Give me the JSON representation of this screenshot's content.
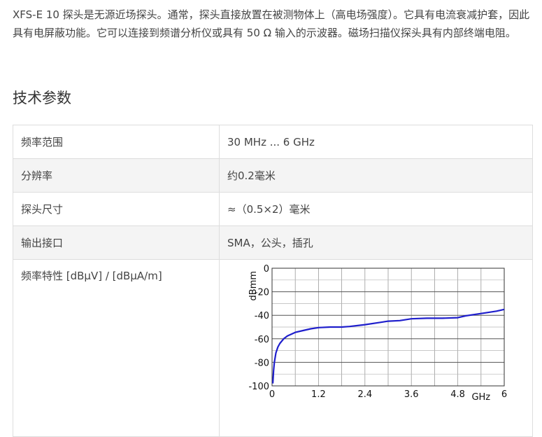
{
  "intro": "XFS-E 10 探头是无源近场探头。通常，探头直接放置在被测物体上（高电场强度）。它具有电流衰减护套，因此具有电屏蔽功能。它可以连接到频谱分析仪或具有 50 Ω 输入的示波器。磁场扫描仪探头具有内部终端电阻。",
  "section_title": "技术参数",
  "specs": [
    {
      "key": "频率范围",
      "value": "30 MHz ... 6 GHz"
    },
    {
      "key": "分辨率",
      "value": "约0.2毫米"
    },
    {
      "key": "探头尺寸",
      "value": "≈（0.5×2）毫米"
    },
    {
      "key": "输出接口",
      "value": "SMA，公头，插孔"
    },
    {
      "key": "频率特性 [dBµV] / [dBµA/m]"
    }
  ],
  "chart_data": {
    "type": "line",
    "xlabel": "GHz",
    "ylabel": "dBmm",
    "xlim": [
      0,
      6
    ],
    "ylim": [
      -100,
      0
    ],
    "xticks": [
      "0",
      "1.2",
      "2.4",
      "3.6",
      "4.8",
      "6"
    ],
    "yticks": [
      "0",
      "-20",
      "-40",
      "-60",
      "-80",
      "-100"
    ],
    "grid": true,
    "series": [
      {
        "color": "#1f1fcc",
        "x": [
          0.02,
          0.04,
          0.06,
          0.1,
          0.15,
          0.2,
          0.3,
          0.4,
          0.5,
          0.6,
          0.8,
          1.0,
          1.2,
          1.5,
          1.8,
          2.0,
          2.4,
          2.8,
          3.0,
          3.3,
          3.6,
          4.0,
          4.4,
          4.8,
          5.0,
          5.4,
          5.8,
          6.0
        ],
        "y": [
          -98,
          -87,
          -80,
          -72,
          -67,
          -64,
          -60,
          -57.5,
          -56,
          -54.5,
          -53,
          -51.5,
          -50.5,
          -50,
          -50,
          -49.5,
          -48,
          -46,
          -45,
          -44.5,
          -43,
          -42.5,
          -42.5,
          -42,
          -40.5,
          -38.5,
          -36.5,
          -35
        ]
      }
    ]
  }
}
